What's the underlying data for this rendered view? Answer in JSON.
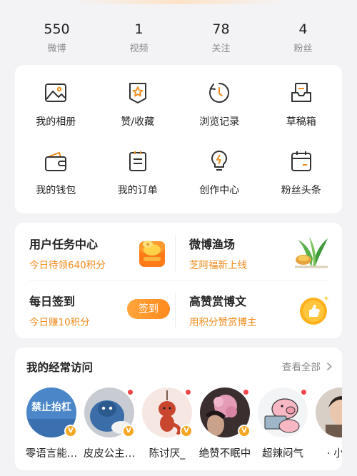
{
  "stats": [
    {
      "value": "550",
      "label": "微博"
    },
    {
      "value": "1",
      "label": "视频"
    },
    {
      "value": "78",
      "label": "关注"
    },
    {
      "value": "4",
      "label": "粉丝"
    }
  ],
  "menu": [
    {
      "label": "我的相册",
      "icon": "photo-album-icon"
    },
    {
      "label": "赞/收藏",
      "icon": "favorites-icon"
    },
    {
      "label": "浏览记录",
      "icon": "history-icon"
    },
    {
      "label": "草稿箱",
      "icon": "drafts-icon"
    },
    {
      "label": "我的钱包",
      "icon": "wallet-icon"
    },
    {
      "label": "我的订单",
      "icon": "orders-icon"
    },
    {
      "label": "创作中心",
      "icon": "lightbulb-icon"
    },
    {
      "label": "粉丝头条",
      "icon": "calendar-icon"
    }
  ],
  "promos": {
    "tasks": {
      "title": "用户任务中心",
      "sub": "今日待领640积分"
    },
    "fishery": {
      "title": "微博渔场",
      "sub": "芝阿福新上线"
    },
    "checkin": {
      "title": "每日签到",
      "sub": "今日赚10积分",
      "button": "签到"
    },
    "praise": {
      "title": "高赞赏博文",
      "sub": "用积分赞赏博主"
    }
  },
  "frequent": {
    "title": "我的经常访问",
    "see_all": "查看全部",
    "users": [
      {
        "name": "零语言能…",
        "sign_text": "禁止抬杠"
      },
      {
        "name": "皮皮公主…"
      },
      {
        "name": "陈讨厌_"
      },
      {
        "name": "绝赞不眠中"
      },
      {
        "name": "超辣闷气"
      },
      {
        "name": "· 小糖"
      }
    ]
  },
  "colors": {
    "accent": "#f08a1a",
    "badge": "#f5a623",
    "dot": "#f04646"
  }
}
